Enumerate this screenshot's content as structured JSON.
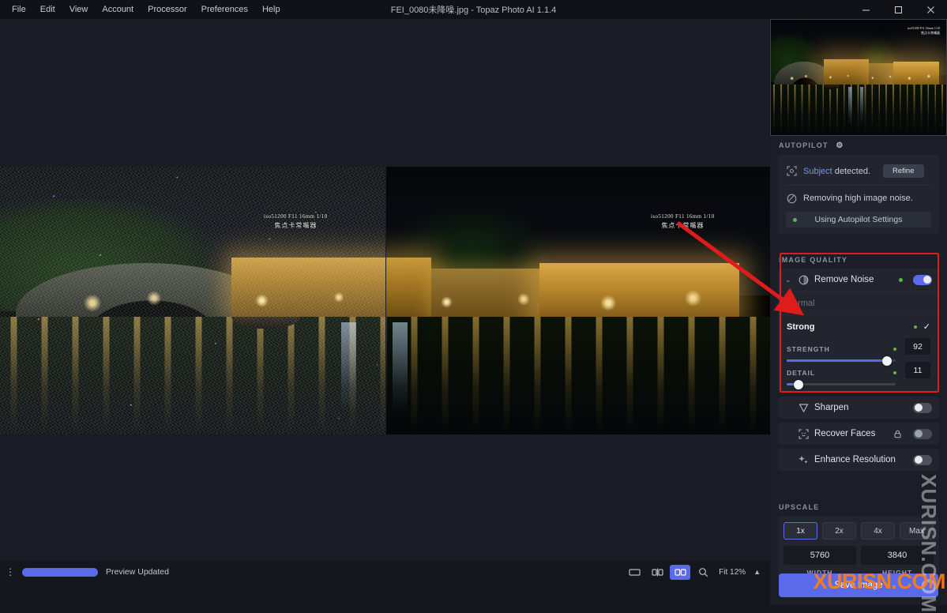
{
  "window": {
    "title": "FEI_0080未降噪.jpg - Topaz Photo AI 1.1.4",
    "minimize": "–",
    "maximize": "□",
    "close": "✕"
  },
  "menubar": {
    "items": [
      {
        "label": "File"
      },
      {
        "label": "Edit"
      },
      {
        "label": "View"
      },
      {
        "label": "Account"
      },
      {
        "label": "Processor"
      },
      {
        "label": "Preferences"
      },
      {
        "label": "Help"
      }
    ]
  },
  "canvas": {
    "exif_overlay": {
      "line1": "iso51200 F11 16mm 1/10",
      "line2": "焦点卡常嘴器"
    }
  },
  "thumbnail": {
    "exif_line1": "iso51200 F11 16mm 1/10",
    "exif_line2": "焦点卡常嘴器"
  },
  "autopilot": {
    "section_label": "AUTOPILOT",
    "gear_icon": "gear-icon",
    "subject_icon": "subject-detect-icon",
    "subject_link": "Subject",
    "subject_text": " detected.",
    "refine_label": "Refine",
    "noise_icon": "noise-icon",
    "noise_text": "Removing high image noise.",
    "settings_pill": "Using Autopilot Settings"
  },
  "image_quality": {
    "section_label": "IMAGE QUALITY",
    "remove_noise": {
      "name": "Remove Noise",
      "chevron": "⌄",
      "enabled": true,
      "presets": [
        {
          "label": "Normal",
          "selected": false
        },
        {
          "label": "Strong",
          "selected": true,
          "check": "✓"
        }
      ],
      "sliders": [
        {
          "label": "STRENGTH",
          "value": "92",
          "percent": 92
        },
        {
          "label": "DETAIL",
          "value": "11",
          "percent": 11
        }
      ]
    },
    "sharpen": {
      "name": "Sharpen",
      "enabled": false
    },
    "recover_faces": {
      "name": "Recover Faces",
      "enabled": false,
      "lock_icon": "lock-icon"
    },
    "enhance_resolution": {
      "name": "Enhance Resolution",
      "enabled": false
    }
  },
  "upscale": {
    "section_label": "UPSCALE",
    "buttons": [
      {
        "label": "1x",
        "selected": true
      },
      {
        "label": "2x",
        "selected": false
      },
      {
        "label": "4x",
        "selected": false
      },
      {
        "label": "Max",
        "selected": false
      }
    ],
    "width_value": "5760",
    "width_label": "WIDTH",
    "height_value": "3840",
    "height_label": "HEIGHT"
  },
  "save": {
    "label": "Save Image"
  },
  "statusbar": {
    "kebab": "⋮",
    "status_text": "Preview Updated",
    "zoom_label": "Fit 12%",
    "caret": "▲",
    "view_single": "single-view",
    "view_compare": "compare-view",
    "view_split": "split-view"
  },
  "watermark": {
    "vertical": "XURISN.COM",
    "orange": "XURISN.COM"
  },
  "colors": {
    "accent": "#5a6ae8",
    "annotation_red": "#e01b1b",
    "green_dot": "#57b84a",
    "link_blue": "#7b93e8",
    "watermark_orange": "#ff7d14"
  }
}
